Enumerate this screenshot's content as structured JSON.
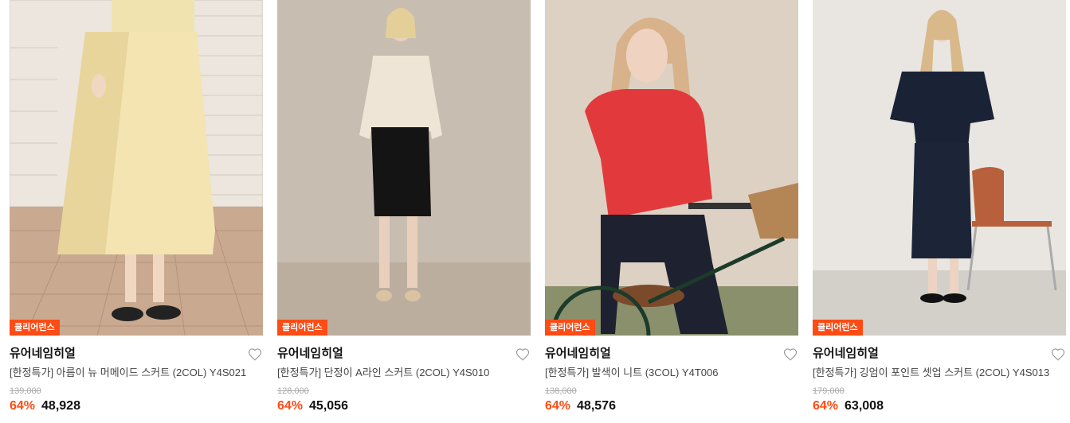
{
  "products": [
    {
      "badge": "클리어런스",
      "brand": "유어네임히얼",
      "title": "[한정특가] 아름이 뉴 머메이드 스커트 (2COL) Y4S021",
      "original_price": "139,000",
      "discount": "64%",
      "price": "48,928"
    },
    {
      "badge": "클리어런스",
      "brand": "유어네임히얼",
      "title": "[한정특가] 단정이 A라인 스커트 (2COL) Y4S010",
      "original_price": "128,000",
      "discount": "64%",
      "price": "45,056"
    },
    {
      "badge": "클리어런스",
      "brand": "유어네임히얼",
      "title": "[한정특가] 발색이 니트 (3COL) Y4T006",
      "original_price": "138,000",
      "discount": "64%",
      "price": "48,576"
    },
    {
      "badge": "클리어런스",
      "brand": "유어네임히얼",
      "title": "[한정특가] 깅엄이 포인트 셋업 스커트 (2COL) Y4S013",
      "original_price": "179,000",
      "discount": "64%",
      "price": "63,008"
    }
  ],
  "colors": {
    "accent": "#ff4b14",
    "strike": "#aaaaaa"
  },
  "icons": {
    "wishlist": "heart-outline-icon"
  }
}
